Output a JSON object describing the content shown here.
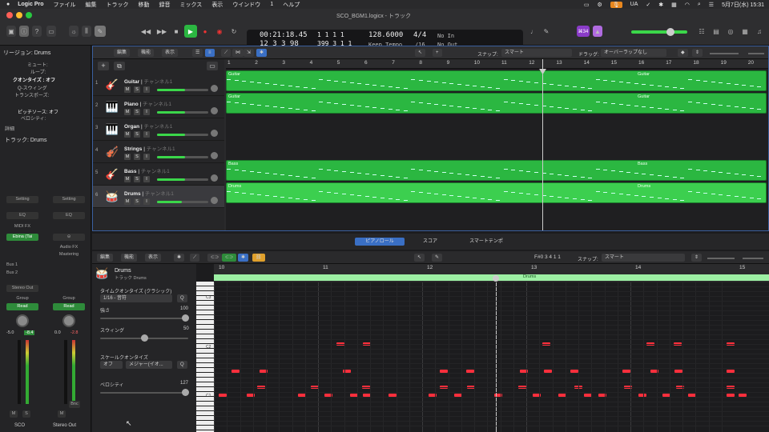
{
  "menubar": {
    "app": "Logic Pro",
    "items": [
      "ファイル",
      "編集",
      "トラック",
      "移動",
      "録音",
      "ミックス",
      "表示",
      "ウインドウ",
      "1",
      "ヘルプ"
    ],
    "input_source": "UA",
    "datetime": "5月7日(水)  15:31"
  },
  "window": {
    "title": "SCO_BGM1.logicx - トラック"
  },
  "lcd": {
    "time": "00:21:18.45",
    "bars": "12  3  3     98",
    "loc1": "1    1    1     1",
    "loc2": "399   3    1     1",
    "tempo": "128.6000",
    "tempo_mode": "Keep Tempo",
    "sig": "4/4",
    "div": "/16",
    "in": "No In",
    "out": "No Out",
    "badge": "⌘34"
  },
  "inspector": {
    "region_label": "リージョン: Drums",
    "mute": "ミュート:",
    "loop": "ループ:",
    "quantize_label": "クオンタイズ",
    "quantize_value": "オフ",
    "q_swing": "Q-スウィング",
    "transpose": "トランスポーズ:",
    "velocity_label": "ベロシティ:",
    "pitch_label": "ピッチソース:",
    "pitch_value": "オフ",
    "detail": "詳細",
    "track_label": "トラック: Drums",
    "strip1": {
      "setting": "Setting",
      "eq": "EQ",
      "midi_fx": "MIDI FX",
      "instrument": "Ebina (Tai",
      "send1": "Bus 1",
      "send2": "Bus 2",
      "output": "Stereo Out",
      "group": "Group",
      "read": "Read",
      "pan_val": "-5.0",
      "peak": "-8.4",
      "m": "M",
      "s": "S",
      "name": "SCO"
    },
    "strip2": {
      "setting": "Setting",
      "eq": "EQ",
      "link": "⊝",
      "audio_fx": "Audio FX",
      "mastering": "Mastering",
      "group": "Group",
      "read": "Read",
      "pan_val": "0.0",
      "peak": "-2.8",
      "m": "M",
      "bnc": "Bnc",
      "name": "Stereo Out"
    }
  },
  "tracks_toolbar": {
    "edit": "編集",
    "func": "機能",
    "view": "表示",
    "snap_label": "スナップ:",
    "snap_value": "スマート",
    "drag_label": "ドラッグ:",
    "drag_value": "オーバーラップなし"
  },
  "tracks": [
    {
      "num": "1",
      "name": "Guitar",
      "channel": "チャンネル1",
      "icon": "🎸",
      "vol": 0.55
    },
    {
      "num": "2",
      "name": "Piano",
      "channel": "チャンネル1",
      "icon": "🎹",
      "vol": 0.55
    },
    {
      "num": "3",
      "name": "Organ",
      "channel": "チャンネル1",
      "icon": "🎹",
      "vol": 0.55
    },
    {
      "num": "4",
      "name": "Strings",
      "channel": "チャンネル1",
      "icon": "🎻",
      "vol": 0.55
    },
    {
      "num": "5",
      "name": "Bass",
      "channel": "チャンネル1",
      "icon": "🎸",
      "vol": 0.55
    },
    {
      "num": "6",
      "name": "Drums",
      "channel": "チャンネル1",
      "icon": "🥁",
      "vol": 0.48
    }
  ],
  "ruler_bars": [
    "1",
    "2",
    "3",
    "4",
    "5",
    "6",
    "7",
    "8",
    "9",
    "10",
    "11",
    "12",
    "13",
    "14",
    "15",
    "16",
    "17",
    "18",
    "19",
    "20"
  ],
  "regions": [
    {
      "track": 0,
      "label": "Guitar",
      "label2": "Guitar"
    },
    {
      "track": 1,
      "label": "Guitar",
      "label2": "Guitar"
    },
    {
      "track": 4,
      "label": "Bass",
      "label2": "Bass"
    },
    {
      "track": 5,
      "label": "Drums",
      "label2": "Drums"
    }
  ],
  "lower_tabs": [
    "ピアノロール",
    "スコア",
    "スマートテンポ"
  ],
  "piano_roll": {
    "edit": "編集",
    "func": "機能",
    "view": "表示",
    "position": "F#0   3 4 1 1",
    "snap_label": "スナップ:",
    "snap_value": "スマート",
    "region_name": "Drums",
    "track_name": "トラック Drums",
    "quantize_title": "タイムクオンタイズ (クラシック)",
    "quantize_value": "1/16 - 音符",
    "q_btn": "Q",
    "strength_label": "強さ",
    "strength_value": "100",
    "swing_label": "スウィング",
    "swing_value": "50",
    "scale_title": "スケールクオンタイズ",
    "scale_off": "オフ",
    "scale_value": "メジャー(イオ...",
    "velocity_label": "ベロシティ",
    "velocity_value": "127",
    "ruler_bars": [
      "10",
      "11",
      "12",
      "13",
      "14",
      "15"
    ],
    "region_strip": "Drums",
    "octaves": [
      "C3",
      "C2",
      "C1"
    ]
  }
}
